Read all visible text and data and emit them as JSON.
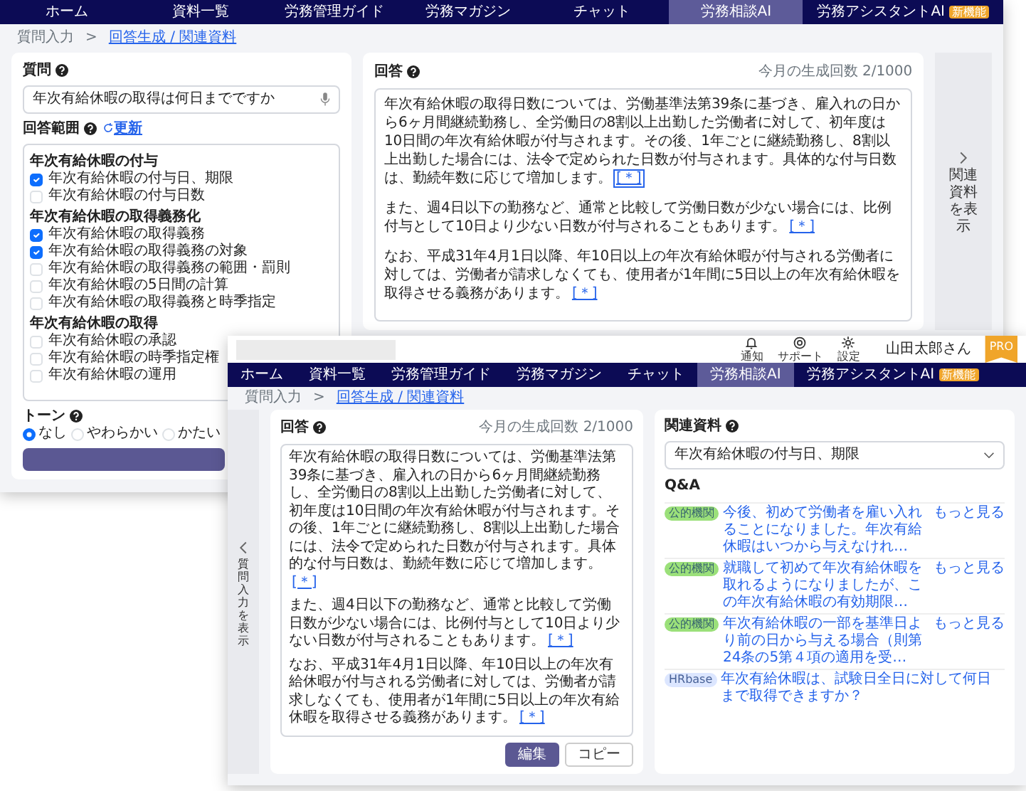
{
  "back_window": {
    "nav": [
      {
        "label": "ホーム",
        "selected": false
      },
      {
        "label": "資料一覧",
        "selected": false
      },
      {
        "label": "労務管理ガイド",
        "selected": false
      },
      {
        "label": "労務マガジン",
        "selected": false
      },
      {
        "label": "チャット",
        "selected": false
      },
      {
        "label": "労務相談AI",
        "selected": true
      },
      {
        "label": "労務アシスタントAI",
        "selected": false,
        "badge": "新機能"
      }
    ],
    "breadcrumb": {
      "separator": ">",
      "items": [
        {
          "label": "質問入力",
          "current": false
        },
        {
          "label": "回答生成 / 関連資料",
          "current": true
        }
      ]
    },
    "question": {
      "label": "質問",
      "value": "年次有給休暇の取得は何日までですか"
    },
    "scope": {
      "label": "回答範囲",
      "refresh": "更新",
      "groups": [
        {
          "heading": "年次有給休暇の付与",
          "items": [
            {
              "label": "年次有給休暇の付与日、期限",
              "checked": true
            },
            {
              "label": "年次有給休暇の付与日数",
              "checked": false
            }
          ]
        },
        {
          "heading": "年次有給休暇の取得義務化",
          "items": [
            {
              "label": "年次有給休暇の取得義務",
              "checked": true
            },
            {
              "label": "年次有給休暇の取得義務の対象",
              "checked": true
            },
            {
              "label": "年次有給休暇の取得義務の範囲・罰則",
              "checked": false
            },
            {
              "label": "年次有給休暇の5日間の計算",
              "checked": false
            },
            {
              "label": "年次有給休暇の取得義務と時季指定",
              "checked": false
            }
          ]
        },
        {
          "heading": "年次有給休暇の取得",
          "items": [
            {
              "label": "年次有給休暇の承認",
              "checked": false
            },
            {
              "label": "年次有給休暇の時季指定権",
              "checked": false
            },
            {
              "label": "年次有給休暇の運用",
              "checked": false
            }
          ]
        }
      ]
    },
    "tone": {
      "label": "トーン",
      "options": [
        {
          "label": "なし",
          "selected": true
        },
        {
          "label": "やわらかい",
          "selected": false
        },
        {
          "label": "かたい",
          "selected": false
        }
      ]
    },
    "answer": {
      "label": "回答",
      "counter": "今月の生成回数 2/1000",
      "paragraphs": [
        {
          "text": "年次有給休暇の取得日数については、労働基準法第39条に基づき、雇入れの日から6ヶ月間継続勤務し、全労働日の8割以上出勤した労働者に対して、初年度は10日間の年次有給休暇が付与されます。その後、1年ごとに継続勤務し、8割以上出勤した場合には、法令で定められた日数が付与されます。具体的な付与日数は、勤続年数に応じて増加します。",
          "cite": "[＊]",
          "cite_focused": true
        },
        {
          "text": "また、週4日以下の勤務など、通常と比較して労働日数が少ない場合には、比例付与として10日より少ない日数が付与されることもあります。",
          "cite": "[＊]",
          "cite_focused": false
        },
        {
          "text": "なお、平成31年4月1日以降、年10日以上の年次有給休暇が付与される労働者に対しては、労働者が請求しなくても、使用者が1年間に5日以上の年次有給休暇を取得させる義務があります。",
          "cite": "[＊]",
          "cite_focused": false
        }
      ]
    },
    "side_handle": "関連資料を表示"
  },
  "front_window": {
    "header": {
      "actions": [
        {
          "kind": "bell",
          "label": "通知"
        },
        {
          "kind": "support",
          "label": "サポート"
        },
        {
          "kind": "gear",
          "label": "設定"
        }
      ],
      "user": "山田太郎さん",
      "plan": "PRO"
    },
    "nav": [
      {
        "label": "ホーム",
        "selected": false
      },
      {
        "label": "資料一覧",
        "selected": false
      },
      {
        "label": "労務管理ガイド",
        "selected": false
      },
      {
        "label": "労務マガジン",
        "selected": false
      },
      {
        "label": "チャット",
        "selected": false
      },
      {
        "label": "労務相談AI",
        "selected": true
      },
      {
        "label": "労務アシスタントAI",
        "selected": false,
        "badge": "新機能"
      }
    ],
    "breadcrumb": {
      "separator": ">",
      "items": [
        {
          "label": "質問入力",
          "current": false
        },
        {
          "label": "回答生成 / 関連資料",
          "current": true
        }
      ]
    },
    "side_handle": "質問入力を表示",
    "answer": {
      "label": "回答",
      "counter": "今月の生成回数 2/1000",
      "paragraphs": [
        {
          "text": "年次有給休暇の取得日数については、労働基準法第39条に基づき、雇入れの日から6ヶ月間継続勤務し、全労働日の8割以上出勤した労働者に対して、初年度は10日間の年次有給休暇が付与されます。その後、1年ごとに継続勤務し、8割以上出勤した場合には、法令で定められた日数が付与されます。具体的な付与日数は、勤続年数に応じて増加します。",
          "cite": "[＊]",
          "cite_focused": false
        },
        {
          "text": "また、週4日以下の勤務など、通常と比較して労働日数が少ない場合には、比例付与として10日より少ない日数が付与されることもあります。",
          "cite": "[＊]",
          "cite_focused": false
        },
        {
          "text": "なお、平成31年4月1日以降、年10日以上の年次有給休暇が付与される労働者に対しては、労働者が請求しなくても、使用者が1年間に5日以上の年次有給休暇を取得させる義務があります。",
          "cite": "[＊]",
          "cite_focused": false
        }
      ]
    },
    "buttons": [
      {
        "label": "編集",
        "kind": "primary"
      },
      {
        "label": "コピー",
        "kind": "secondary"
      }
    ],
    "related": {
      "label": "関連資料",
      "select": "年次有給休暇の付与日、期限",
      "section": "Q&A",
      "items": [
        {
          "tag": "公的機関",
          "color": "#9be07a",
          "text": "今後、初めて労働者を雇い入れることになりました。年次有給休暇はいつから与えなけれ…",
          "more": "もっと見る"
        },
        {
          "tag": "公的機関",
          "color": "#9be07a",
          "text": "就職して初めて年次有給休暇を取れるようになりましたが、この年次有給休暇の有効期限…",
          "more": "もっと見る"
        },
        {
          "tag": "公的機関",
          "color": "#9be07a",
          "text": "年次有給休暇の一部を基準日より前の日から与える場合（則第24条の5第４項の適用を受…",
          "more": "もっと見る"
        },
        {
          "tag": "HRbase",
          "color": "#dce6ff",
          "text": "年次有給休暇は、試験日全日に対して何日まで取得できますか？"
        }
      ]
    }
  }
}
